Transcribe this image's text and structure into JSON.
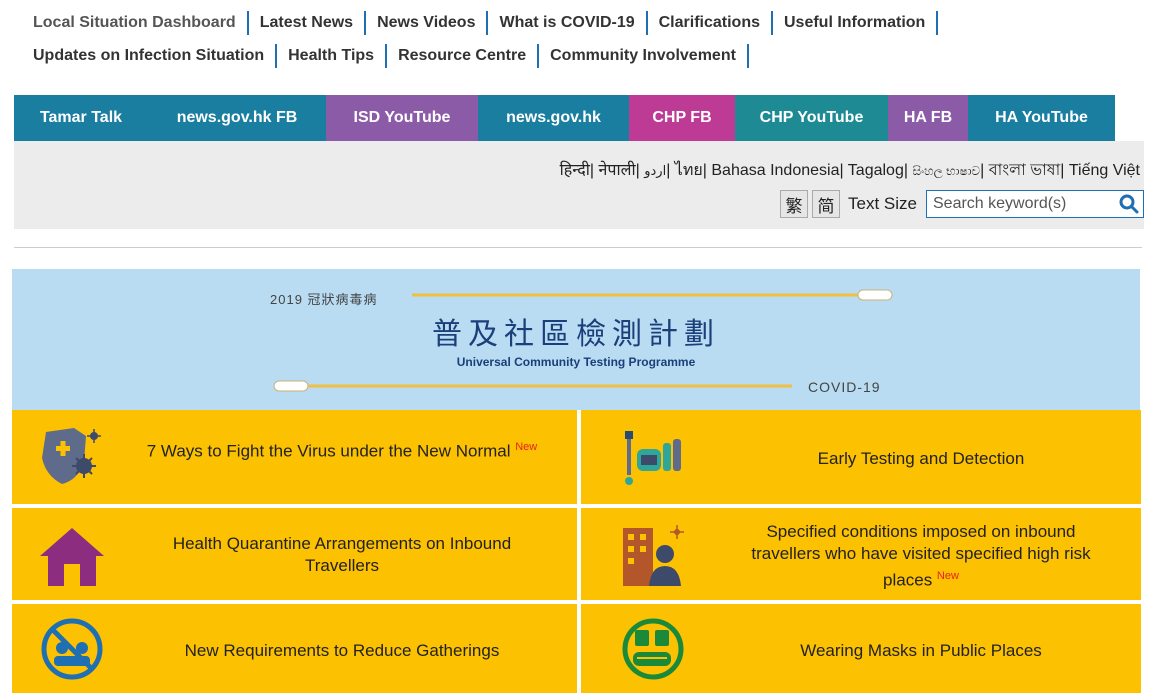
{
  "topnav": {
    "row1": [
      "Local Situation Dashboard",
      "Latest News",
      "News Videos",
      "What is COVID-19",
      "Clarifications",
      "Useful Information"
    ],
    "row2": [
      "Updates on Infection Situation",
      "Health Tips",
      "Resource Centre",
      "Community Involvement"
    ]
  },
  "social": [
    {
      "label": "Tamar Talk",
      "color": "#1a7ea0"
    },
    {
      "label": "news.gov.hk FB",
      "color": "#1a7ea0"
    },
    {
      "label": "ISD YouTube",
      "color": "#8c5ba8"
    },
    {
      "label": "news.gov.hk",
      "color": "#1a7ea0"
    },
    {
      "label": "CHP FB",
      "color": "#bd3a95"
    },
    {
      "label": "CHP YouTube",
      "color": "#1e8a94"
    },
    {
      "label": "HA FB",
      "color": "#8c5ba8"
    },
    {
      "label": "HA YouTube",
      "color": "#1a7ea0"
    }
  ],
  "languages": [
    "हिन्दी",
    "नेपाली",
    "اردو",
    "ไทย",
    "Bahasa Indonesia",
    "Tagalog",
    "සිංහල භාෂාව",
    "বাংলা ভাষা",
    "Tiếng Việt"
  ],
  "tools": {
    "traditional": "繁",
    "simplified": "简",
    "text_size": "Text Size",
    "search_placeholder": "Search keyword(s)"
  },
  "banner": {
    "year_line": "2019 冠狀病毒病",
    "title_zh": "普及社區檢測計劃",
    "title_en": "Universal Community Testing Programme",
    "covid": "COVID-19"
  },
  "tiles": [
    {
      "label": "7 Ways to Fight the Virus under the New Normal",
      "new": "New",
      "icon": "virus-shield-icon"
    },
    {
      "label": "Early Testing and Detection",
      "new": "",
      "icon": "test-kit-icon"
    },
    {
      "label": "Health Quarantine Arrangements on Inbound Travellers",
      "new": "",
      "icon": "house-icon"
    },
    {
      "label": "Specified conditions imposed on inbound travellers who have visited specified high risk places",
      "new": "New",
      "icon": "traveller-building-icon"
    },
    {
      "label": "New Requirements to Reduce Gatherings",
      "new": "",
      "icon": "no-gathering-icon"
    },
    {
      "label": "Wearing Masks in Public Places",
      "new": "",
      "icon": "mask-transport-icon"
    }
  ],
  "colors": {
    "tile": "#fcc100",
    "banner": "#b9dcf3",
    "nav_separator": "#1f6fb3",
    "new_badge": "#e8231b"
  }
}
